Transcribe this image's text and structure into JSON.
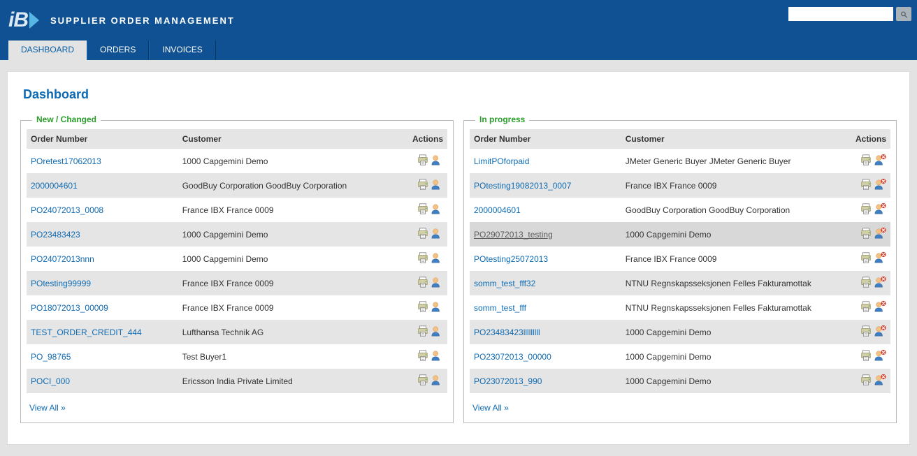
{
  "header": {
    "logo_text": "iB",
    "app_title": "SUPPLIER ORDER MANAGEMENT",
    "search_placeholder": ""
  },
  "tabs": [
    {
      "label": "DASHBOARD",
      "active": true
    },
    {
      "label": "ORDERS",
      "active": false
    },
    {
      "label": "INVOICES",
      "active": false
    }
  ],
  "page_title": "Dashboard",
  "columns": {
    "order_number": "Order Number",
    "customer": "Customer",
    "actions": "Actions"
  },
  "view_all_label": "View All »",
  "panels": {
    "new_changed": {
      "legend": "New / Changed",
      "rows": [
        {
          "order": "POretest17062013",
          "customer": "1000 Capgemini Demo",
          "highlight": false
        },
        {
          "order": "2000004601",
          "customer": "GoodBuy Corporation GoodBuy Corporation",
          "highlight": false
        },
        {
          "order": "PO24072013_0008",
          "customer": "France IBX France 0009",
          "highlight": false
        },
        {
          "order": "PO23483423",
          "customer": "1000 Capgemini Demo",
          "highlight": false
        },
        {
          "order": "PO24072013nnn",
          "customer": "1000 Capgemini Demo",
          "highlight": false
        },
        {
          "order": "POtesting99999",
          "customer": "France IBX France 0009",
          "highlight": false
        },
        {
          "order": "PO18072013_00009",
          "customer": "France IBX France 0009",
          "highlight": false
        },
        {
          "order": "TEST_ORDER_CREDIT_444",
          "customer": "Lufthansa Technik AG",
          "highlight": false
        },
        {
          "order": "PO_98765",
          "customer": "Test Buyer1",
          "highlight": false
        },
        {
          "order": "POCI_000",
          "customer": "Ericsson India Private Limited",
          "highlight": false
        }
      ],
      "red_marker": false
    },
    "in_progress": {
      "legend": "In progress",
      "rows": [
        {
          "order": "LimitPOforpaid",
          "customer": "JMeter Generic Buyer JMeter Generic Buyer",
          "highlight": false
        },
        {
          "order": "POtesting19082013_0007",
          "customer": "France IBX France 0009",
          "highlight": false
        },
        {
          "order": "2000004601",
          "customer": "GoodBuy Corporation GoodBuy Corporation",
          "highlight": false
        },
        {
          "order": "PO29072013_testing",
          "customer": "1000 Capgemini Demo",
          "highlight": true
        },
        {
          "order": "POtesting25072013",
          "customer": "France IBX France 0009",
          "highlight": false
        },
        {
          "order": "somm_test_fff32",
          "customer": "NTNU Regnskapsseksjonen Felles Fakturamottak",
          "highlight": false
        },
        {
          "order": "somm_test_fff",
          "customer": "NTNU Regnskapsseksjonen Felles Fakturamottak",
          "highlight": false
        },
        {
          "order": "PO23483423lllllllll",
          "customer": "1000 Capgemini Demo",
          "highlight": false
        },
        {
          "order": "PO23072013_00000",
          "customer": "1000 Capgemini Demo",
          "highlight": false
        },
        {
          "order": "PO23072013_990",
          "customer": "1000 Capgemini Demo",
          "highlight": false
        }
      ],
      "red_marker": true
    }
  }
}
